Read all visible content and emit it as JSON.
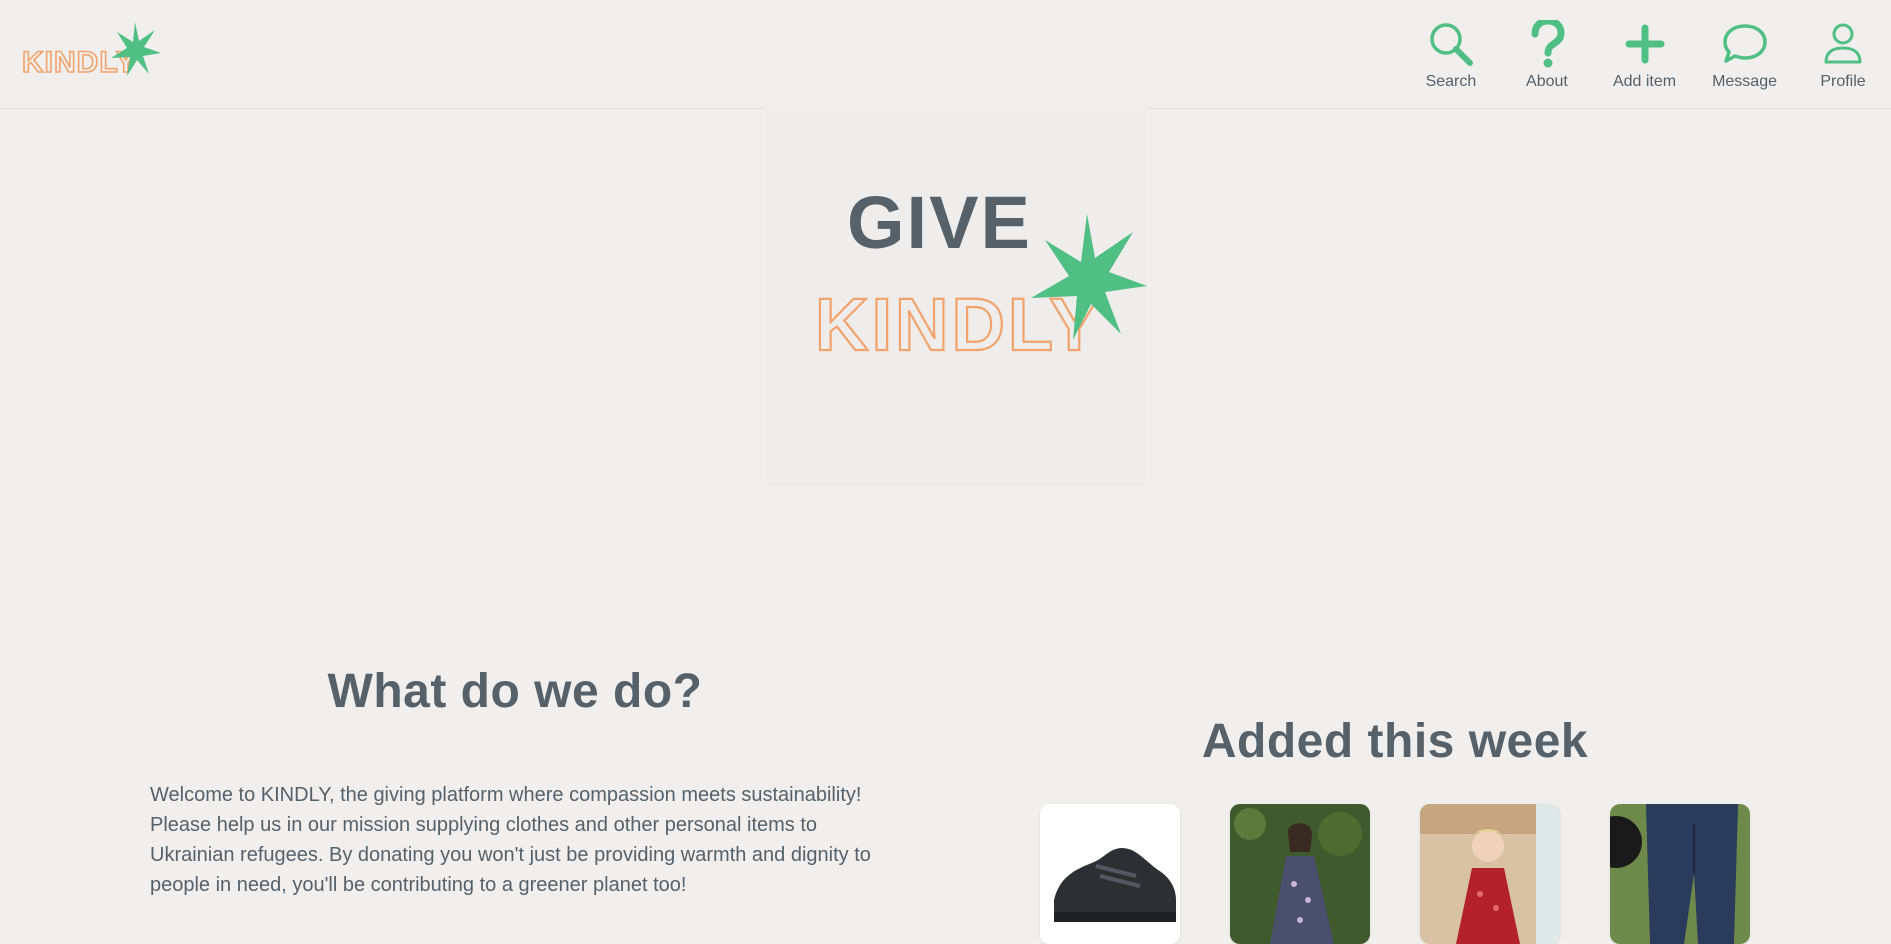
{
  "brand": {
    "logo_text": "KINDLY",
    "colors": {
      "green": "#4fbf84",
      "orange": "#f2a36b",
      "slate": "#56616a",
      "background": "#f0efed"
    }
  },
  "nav": {
    "items": [
      {
        "label": "Search",
        "icon": "search-icon"
      },
      {
        "label": "About",
        "icon": "question-icon"
      },
      {
        "label": "Add item",
        "icon": "plus-icon"
      },
      {
        "label": "Message",
        "icon": "chat-bubble-icon"
      },
      {
        "label": "Profile",
        "icon": "user-icon"
      }
    ]
  },
  "hero": {
    "line1": "GIVE",
    "line2": "KINDLY"
  },
  "about": {
    "title": "What do we do?",
    "paragraph": "Welcome to KINDLY, the giving platform where compassion meets sustainability! Please help us in our mission supplying clothes and other personal items to Ukrainian refugees. By donating you won't just be providing warmth and dignity to people in need, you'll be contributing to a greener planet too!"
  },
  "recent": {
    "title": "Added this week",
    "items": [
      {
        "name": "Black shoes",
        "icon": "shoe-image"
      },
      {
        "name": "Floral dress",
        "icon": "dress-image"
      },
      {
        "name": "Red sequin dress",
        "icon": "kids-dress-image"
      },
      {
        "name": "Jeans",
        "icon": "jeans-image"
      }
    ]
  }
}
